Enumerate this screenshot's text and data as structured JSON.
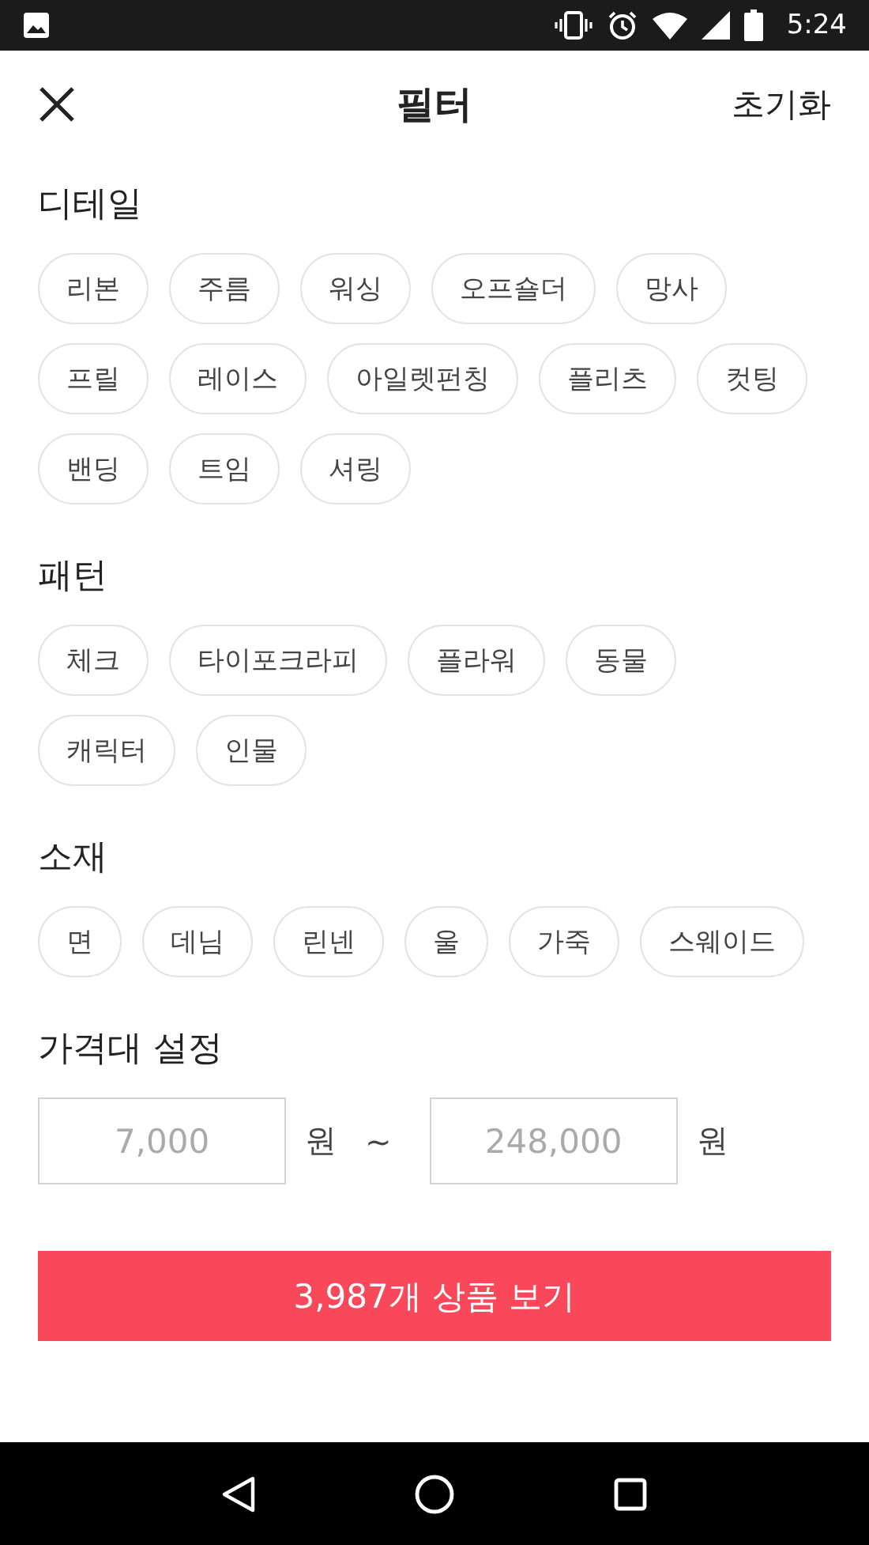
{
  "status_bar": {
    "time": "5:24"
  },
  "header": {
    "title": "필터",
    "reset": "초기화"
  },
  "sections": [
    {
      "title": "디테일",
      "chips": [
        {
          "label": "리본",
          "selected": false
        },
        {
          "label": "주름",
          "selected": false
        },
        {
          "label": "워싱",
          "selected": false
        },
        {
          "label": "오프숄더",
          "selected": false
        },
        {
          "label": "망사",
          "selected": false
        },
        {
          "label": "프릴",
          "selected": false
        },
        {
          "label": "레이스",
          "selected": false
        },
        {
          "label": "아일렛펀칭",
          "selected": false
        },
        {
          "label": "플리츠",
          "selected": false
        },
        {
          "label": "컷팅",
          "selected": false
        },
        {
          "label": "밴딩",
          "selected": false
        },
        {
          "label": "트임",
          "selected": false
        },
        {
          "label": "셔링",
          "selected": false
        }
      ]
    },
    {
      "title": "패턴",
      "chips": [
        {
          "label": "체크",
          "selected": false
        },
        {
          "label": "타이포크라피",
          "selected": false
        },
        {
          "label": "플라워",
          "selected": false
        },
        {
          "label": "동물",
          "selected": false
        },
        {
          "label": "캐릭터",
          "selected": false
        },
        {
          "label": "인물",
          "selected": false
        }
      ]
    },
    {
      "title": "소재",
      "chips": [
        {
          "label": "면",
          "selected": false
        },
        {
          "label": "데님",
          "selected": false
        },
        {
          "label": "린넨",
          "selected": false
        },
        {
          "label": "울",
          "selected": false
        },
        {
          "label": "가죽",
          "selected": false
        },
        {
          "label": "스웨이드",
          "selected": false
        }
      ]
    }
  ],
  "price": {
    "title": "가격대 설정",
    "min": {
      "placeholder": "7,000",
      "unit": "원"
    },
    "separator": "~",
    "max": {
      "placeholder": "248,000",
      "unit": "원"
    }
  },
  "submit": "3,987개 상품 보기"
}
